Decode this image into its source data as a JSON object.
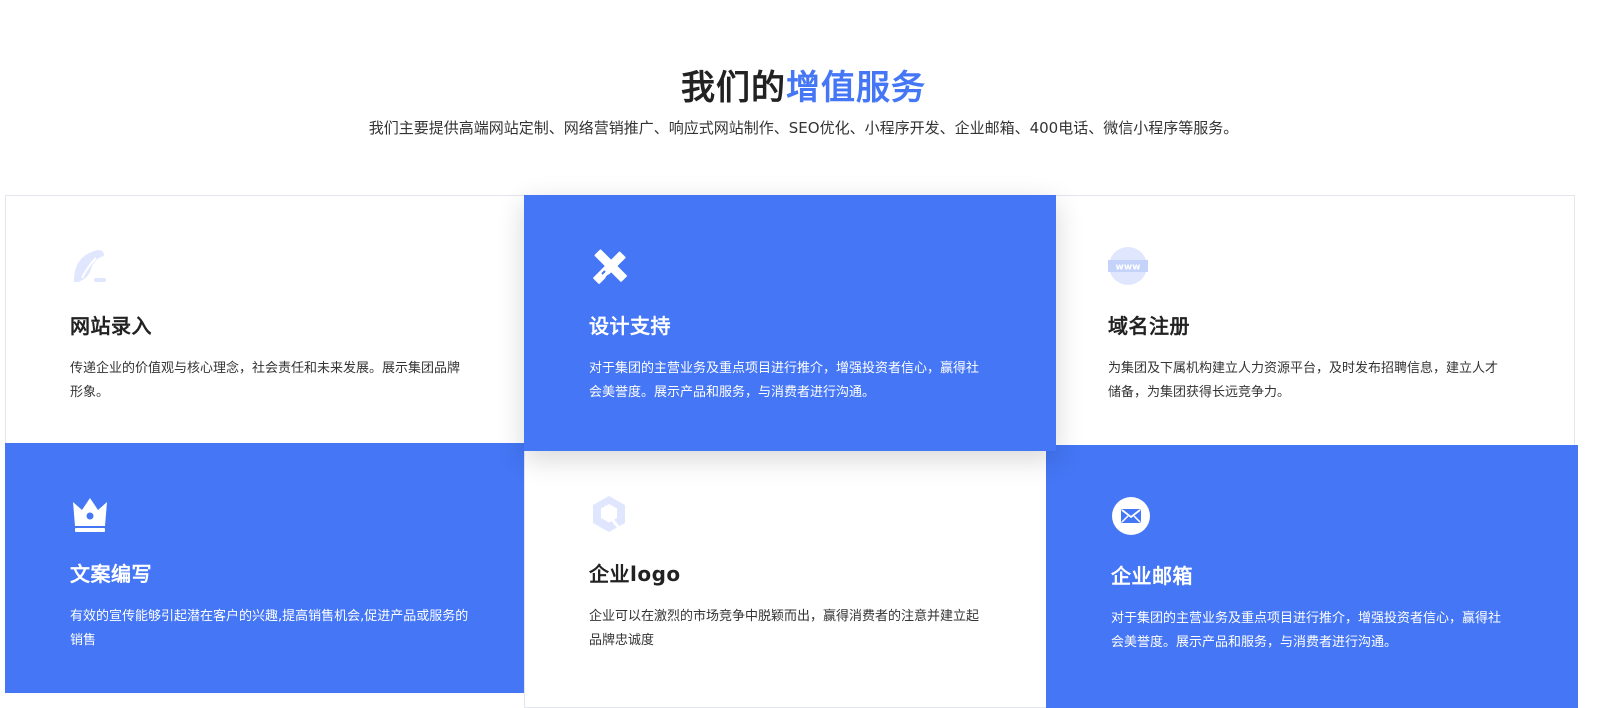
{
  "section": {
    "title_plain": "我们的",
    "title_accent": "增值服务",
    "subtitle": "我们主要提供高端网站定制、网络营销推广、响应式网站制作、SEO优化、小程序开发、企业邮箱、400电话、微信小程序等服务。"
  },
  "colors": {
    "accent": "#4476f5",
    "text_dark": "#222222",
    "icon_light": "#dfe6fd"
  },
  "cards": [
    {
      "icon": "quill-icon",
      "title": "网站录入",
      "desc": "传递企业的价值观与核心理念，社会责任和未来发展。展示集团品牌形象。"
    },
    {
      "icon": "pencil-ruler-icon",
      "title": "设计支持",
      "desc": "对于集团的主营业务及重点项目进行推介，增强投资者信心，赢得社会美誉度。展示产品和服务，与消费者进行沟通。"
    },
    {
      "icon": "www-globe-icon",
      "title": "域名注册",
      "desc": "为集团及下属机构建立人力资源平台，及时发布招聘信息，建立人才储备，为集团获得长远竞争力。"
    },
    {
      "icon": "crown-icon",
      "title": "文案编写",
      "desc": "有效的宣传能够引起潜在客户的兴趣,提高销售机会,促进产品或服务的销售"
    },
    {
      "icon": "hexagon-logo-icon",
      "title": "企业logo",
      "desc": "企业可以在激烈的市场竞争中脱颖而出，赢得消费者的注意并建立起品牌忠诚度"
    },
    {
      "icon": "mail-icon",
      "title": "企业邮箱",
      "desc": "对于集团的主营业务及重点项目进行推介，增强投资者信心，赢得社会美誉度。展示产品和服务，与消费者进行沟通。"
    }
  ]
}
